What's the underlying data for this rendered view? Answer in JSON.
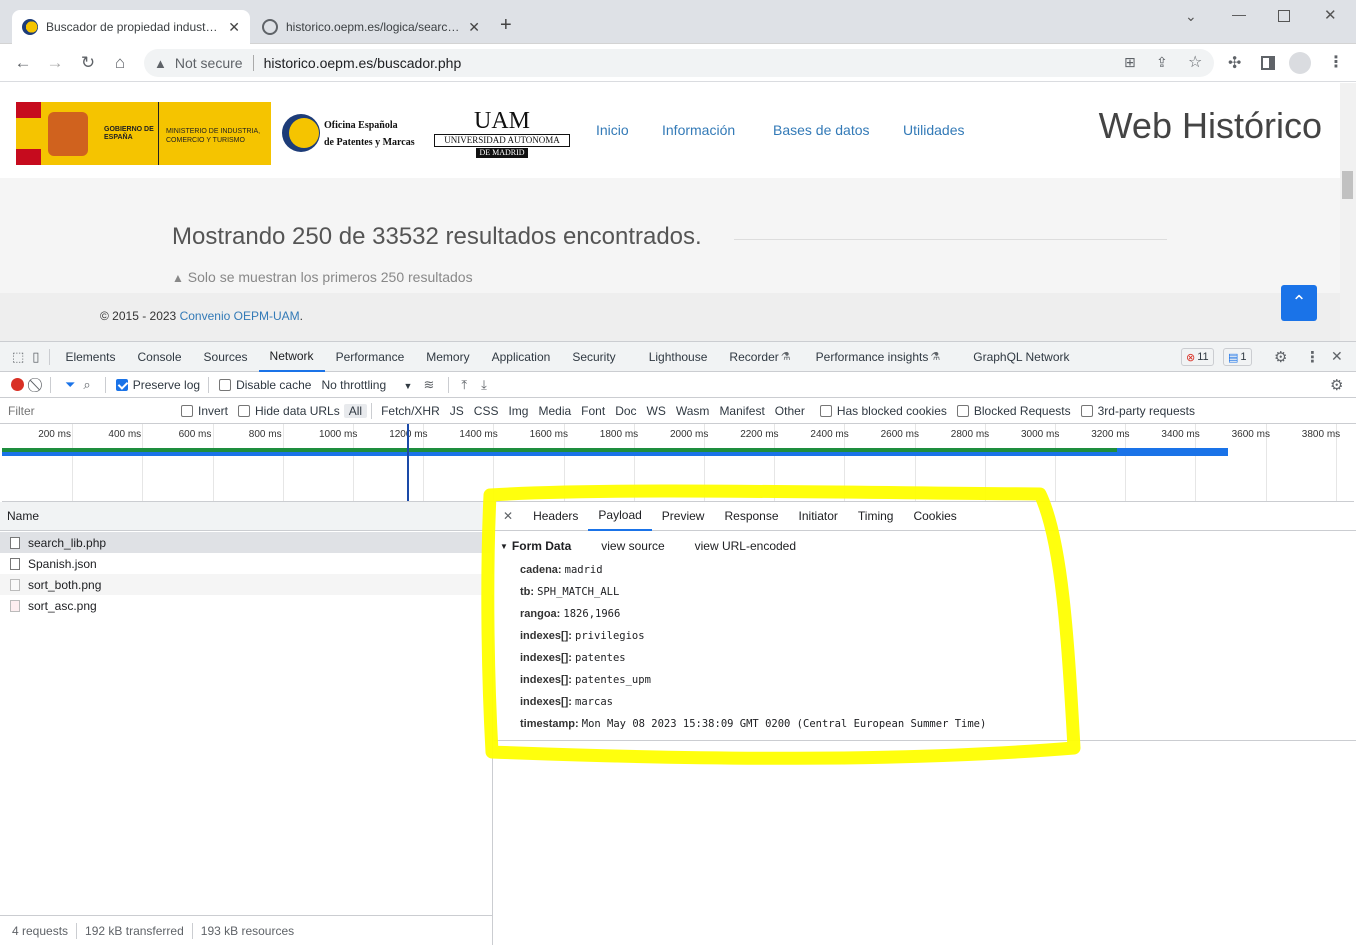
{
  "browser": {
    "tabs": [
      {
        "title": "Buscador de propiedad industrial",
        "active": true
      },
      {
        "title": "historico.oepm.es/logica/search_l",
        "active": false
      }
    ],
    "security_label": "Not secure",
    "url": "historico.oepm.es/buscador.php"
  },
  "site": {
    "logo_gov_text_1": "GOBIERNO DE ESPAÑA",
    "logo_gov_text_2": "MINISTERIO DE INDUSTRIA, COMERCIO Y TURISMO",
    "logo_oepm_line1": "Oficina Española",
    "logo_oepm_line2": "de Patentes y Marcas",
    "logo_uam_big": "UAM",
    "logo_uam_line1": "UNIVERSIDAD AUTONOMA",
    "logo_uam_line2": "DE MADRID",
    "nav": [
      "Inicio",
      "Información",
      "Bases de datos",
      "Utilidades"
    ],
    "site_title": "Web Histórico",
    "results_text": "Mostrando 250 de 33532 resultados encontrados.",
    "warning_text": "Solo se muestran los primeros 250 resultados",
    "footer_prefix": "© 2015 - 2023 ",
    "footer_link": "Convenio OEPM-UAM",
    "footer_suffix": "."
  },
  "devtools": {
    "panels": [
      "Elements",
      "Console",
      "Sources",
      "Network",
      "Performance",
      "Memory",
      "Application",
      "Security",
      "Lighthouse",
      "Recorder",
      "Performance insights",
      "GraphQL Network"
    ],
    "selected_panel": "Network",
    "errors_count": "11",
    "messages_count": "1",
    "preserve_log": "Preserve log",
    "disable_cache": "Disable cache",
    "throttling": "No throttling",
    "filter_placeholder": "Filter",
    "invert": "Invert",
    "hide_data_urls": "Hide data URLs",
    "filter_types": [
      "All",
      "Fetch/XHR",
      "JS",
      "CSS",
      "Img",
      "Media",
      "Font",
      "Doc",
      "WS",
      "Wasm",
      "Manifest",
      "Other"
    ],
    "has_blocked_cookies": "Has blocked cookies",
    "blocked_requests": "Blocked Requests",
    "third_party": "3rd-party requests",
    "timeline_ticks": [
      "200 ms",
      "400 ms",
      "600 ms",
      "800 ms",
      "1000 ms",
      "1200 ms",
      "1400 ms",
      "1600 ms",
      "1800 ms",
      "2000 ms",
      "2200 ms",
      "2400 ms",
      "2600 ms",
      "2800 ms",
      "3000 ms",
      "3200 ms",
      "3400 ms",
      "3600 ms",
      "3800 ms"
    ],
    "name_header": "Name",
    "requests": [
      "search_lib.php",
      "Spanish.json",
      "sort_both.png",
      "sort_asc.png"
    ],
    "detail_tabs": [
      "Headers",
      "Payload",
      "Preview",
      "Response",
      "Initiator",
      "Timing",
      "Cookies"
    ],
    "selected_detail_tab": "Payload",
    "form_data_label": "Form Data",
    "view_source": "view source",
    "view_url_encoded": "view URL-encoded",
    "form_data": [
      {
        "key": "cadena:",
        "value": "madrid"
      },
      {
        "key": "tb:",
        "value": "SPH_MATCH_ALL"
      },
      {
        "key": "rangoa:",
        "value": "1826,1966"
      },
      {
        "key": "indexes[]:",
        "value": "privilegios"
      },
      {
        "key": "indexes[]:",
        "value": "patentes"
      },
      {
        "key": "indexes[]:",
        "value": "patentes_upm"
      },
      {
        "key": "indexes[]:",
        "value": "marcas"
      },
      {
        "key": "timestamp:",
        "value": "Mon May 08 2023 15:38:09 GMT 0200 (Central European Summer Time)"
      }
    ],
    "status_requests": "4 requests",
    "status_transferred": "192 kB transferred",
    "status_resources": "193 kB resources"
  },
  "colors": {
    "link": "#337ab7",
    "highlight": "#ffff00",
    "accent": "#1a73e8"
  }
}
